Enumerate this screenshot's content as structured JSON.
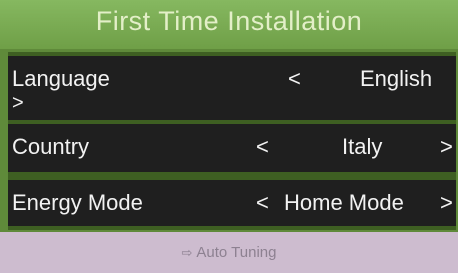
{
  "header": {
    "title": "First Time Installation"
  },
  "settings": {
    "language": {
      "label": "Language",
      "prev": "<",
      "value": "English",
      "next": ">"
    },
    "country": {
      "label": "Country",
      "prev": "<",
      "value": "Italy",
      "next": ">"
    },
    "energy_mode": {
      "label": "Energy Mode",
      "prev": "<",
      "value": "Home Mode",
      "next": ">"
    }
  },
  "footer": {
    "icon": "pointer-arrow-icon",
    "label": "Auto Tuning"
  },
  "colors": {
    "header": "#7aaa52",
    "row": "#1f1f1f",
    "footer": "#cdbccf"
  }
}
